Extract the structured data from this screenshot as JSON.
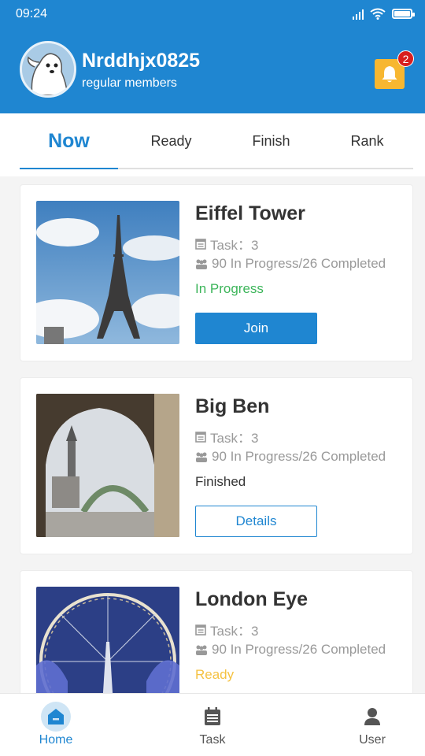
{
  "status_bar": {
    "time": "09:24"
  },
  "profile": {
    "username": "Nrddhjx0825",
    "member_level": "regular members",
    "notification_count": "2"
  },
  "tabs": [
    {
      "label": "Now",
      "active": true
    },
    {
      "label": "Ready",
      "active": false
    },
    {
      "label": "Finish",
      "active": false
    },
    {
      "label": "Rank",
      "active": false
    }
  ],
  "cards": [
    {
      "title": "Eiffel Tower",
      "task": "Task：3",
      "participants": "90 In Progress/26 Completed",
      "status": "In Progress",
      "status_color": "#3cb55a",
      "action": "Join"
    },
    {
      "title": "Big Ben",
      "task": "Task：3",
      "participants": "90 In Progress/26 Completed",
      "status": "Finished",
      "status_color": "#333333",
      "action": "Details"
    },
    {
      "title": "London Eye",
      "task": "Task：3",
      "participants": "90 In Progress/26 Completed",
      "status": "Ready",
      "status_color": "#f5c242",
      "action": ""
    }
  ],
  "bottom_nav": [
    {
      "label": "Home",
      "icon": "home-icon",
      "active": true
    },
    {
      "label": "Task",
      "icon": "task-list-icon",
      "active": false
    },
    {
      "label": "User",
      "icon": "user-icon",
      "active": false
    }
  ],
  "colors": {
    "primary": "#1f86d1",
    "accent": "#f7b731",
    "badge": "#d81e1e"
  }
}
